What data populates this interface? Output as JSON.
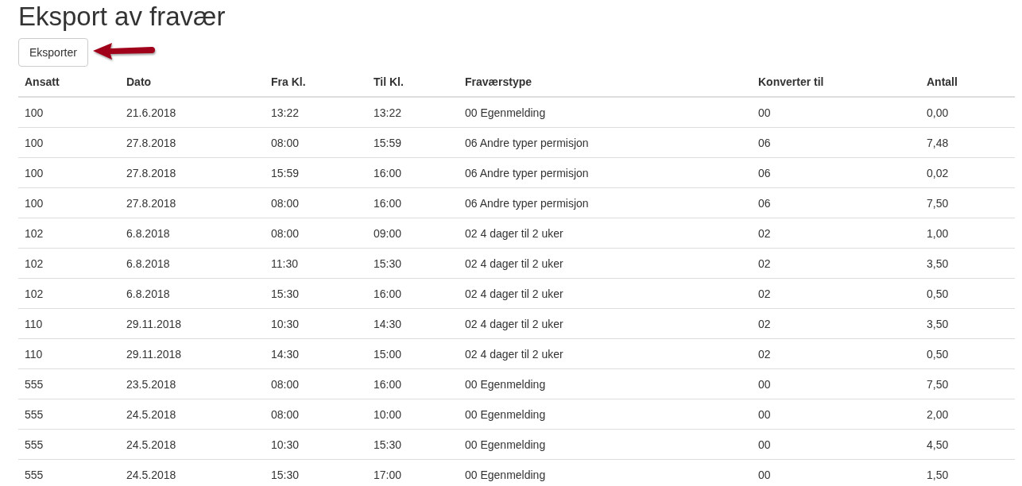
{
  "title": "Eksport av fravær",
  "export_button": {
    "label": "Eksporter"
  },
  "table": {
    "columns": [
      "Ansatt",
      "Dato",
      "Fra Kl.",
      "Til Kl.",
      "Fraværstype",
      "Konverter til",
      "Antall"
    ],
    "rows": [
      [
        "100",
        "21.6.2018",
        "13:22",
        "13:22",
        "00 Egenmelding",
        "00",
        "0,00"
      ],
      [
        "100",
        "27.8.2018",
        "08:00",
        "15:59",
        "06 Andre typer permisjon",
        "06",
        "7,48"
      ],
      [
        "100",
        "27.8.2018",
        "15:59",
        "16:00",
        "06 Andre typer permisjon",
        "06",
        "0,02"
      ],
      [
        "100",
        "27.8.2018",
        "08:00",
        "16:00",
        "06 Andre typer permisjon",
        "06",
        "7,50"
      ],
      [
        "102",
        "6.8.2018",
        "08:00",
        "09:00",
        "02 4 dager til 2 uker",
        "02",
        "1,00"
      ],
      [
        "102",
        "6.8.2018",
        "11:30",
        "15:30",
        "02 4 dager til 2 uker",
        "02",
        "3,50"
      ],
      [
        "102",
        "6.8.2018",
        "15:30",
        "16:00",
        "02 4 dager til 2 uker",
        "02",
        "0,50"
      ],
      [
        "110",
        "29.11.2018",
        "10:30",
        "14:30",
        "02 4 dager til 2 uker",
        "02",
        "3,50"
      ],
      [
        "110",
        "29.11.2018",
        "14:30",
        "15:00",
        "02 4 dager til 2 uker",
        "02",
        "0,50"
      ],
      [
        "555",
        "23.5.2018",
        "08:00",
        "16:00",
        "00 Egenmelding",
        "00",
        "7,50"
      ],
      [
        "555",
        "24.5.2018",
        "08:00",
        "10:00",
        "00 Egenmelding",
        "00",
        "2,00"
      ],
      [
        "555",
        "24.5.2018",
        "10:30",
        "15:30",
        "00 Egenmelding",
        "00",
        "4,50"
      ],
      [
        "555",
        "24.5.2018",
        "15:30",
        "17:00",
        "00 Egenmelding",
        "00",
        "1,50"
      ]
    ]
  }
}
